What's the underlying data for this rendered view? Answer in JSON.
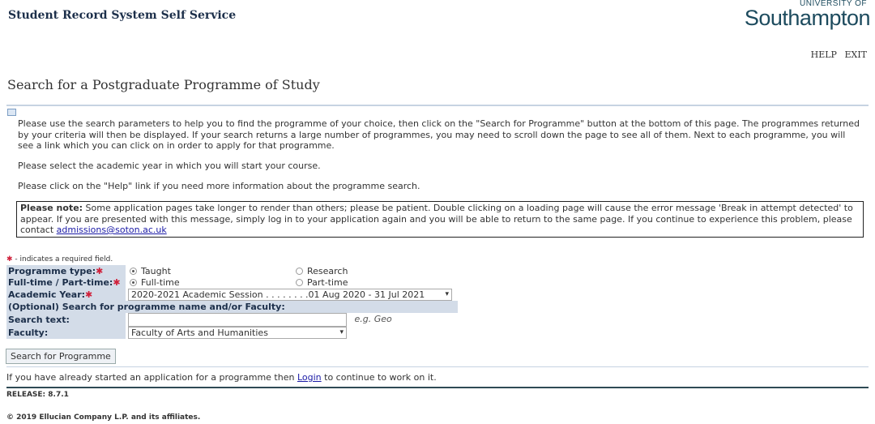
{
  "header": {
    "system_title": "Student Record System Self Service",
    "logo_top": "UNIVERSITY OF",
    "logo_main": "Southampton",
    "help": "HELP",
    "exit": "EXIT"
  },
  "page_title": "Search for a Postgraduate Programme of Study",
  "intro": [
    "Please use the search parameters to help you to find the programme of your choice, then click on the \"Search for Programme\" button at the bottom of this page. The programmes returned by your criteria will then be displayed. If your search returns a large number of programmes, you may need to scroll down the page to see all of them. Next to each programme, you will see a link which you can click on in order to apply for that programme.",
    "Please select the academic year in which you will start your course.",
    "Please click on the \"Help\" link if you need more information about the programme search."
  ],
  "note": {
    "label": "Please note:",
    "text": " Some application pages take longer to render than others; please be patient. Double clicking on a loading page will cause the error message 'Break in attempt detected' to appear. If you are presented with this message, simply log in to your application again and you will be able to return to the same page. If you continue to experience this problem, please contact ",
    "email": "admissions@soton.ac.uk"
  },
  "required_legend": " - indicates a required field.",
  "form": {
    "programme_type": {
      "label": "Programme type:",
      "options": [
        "Taught",
        "Research"
      ],
      "selected": "Taught"
    },
    "mode": {
      "label": "Full-time / Part-time:",
      "options": [
        "Full-time",
        "Part-time"
      ],
      "selected": "Full-time"
    },
    "academic_year": {
      "label": "Academic Year:",
      "value": "2020-2021 Academic Session . . . . . . . .01 Aug 2020 - 31 Jul 2021"
    },
    "optional_header": "(Optional) Search for programme name and/or Faculty:",
    "search_text": {
      "label": "Search text:",
      "value": "",
      "hint": "e.g. Geo"
    },
    "faculty": {
      "label": "Faculty:",
      "value": "Faculty of Arts and Humanities"
    },
    "submit": "Search for Programme"
  },
  "login_line": {
    "before": "If you have already started an application for a programme then ",
    "link": "Login",
    "after": " to continue to work on it."
  },
  "release": "RELEASE: 8.7.1",
  "copyright": "© 2019 Ellucian Company L.P. and its affiliates.",
  "colors": {
    "label_bg": "#d3dce8",
    "required": "#d0203a",
    "link": "#1a1aa6"
  }
}
